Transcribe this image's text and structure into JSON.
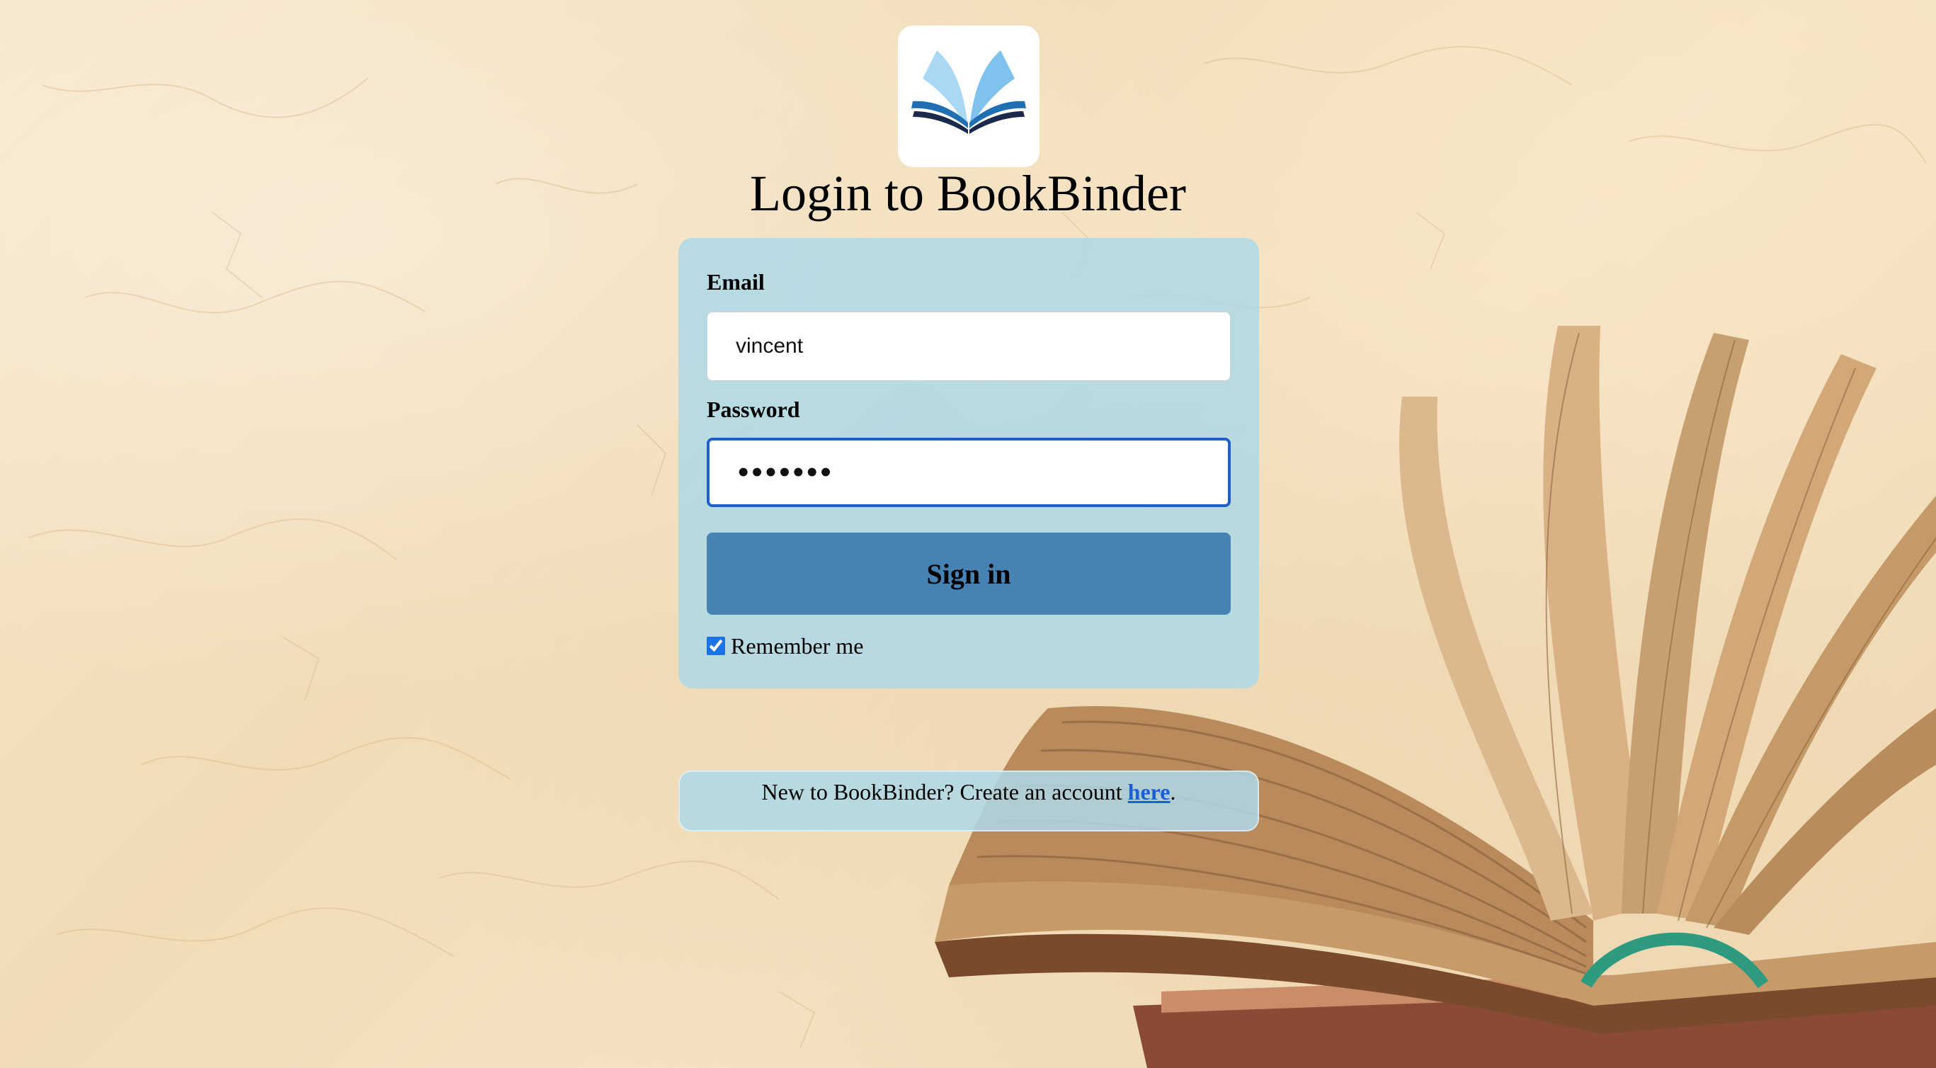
{
  "header": {
    "title": "Login to BookBinder",
    "logo_icon": "open-book-icon"
  },
  "login_form": {
    "email_label": "Email",
    "email_value": "vincent",
    "password_label": "Password",
    "password_value": "•••••••",
    "sign_in_label": "Sign in",
    "remember_label": "Remember me",
    "remember_checked": true
  },
  "signup": {
    "prompt": "New to BookBinder? Create an account ",
    "link_text": "here",
    "suffix": "."
  },
  "colors": {
    "card_background": "#add8e6",
    "button_background": "#4682b4",
    "focus_border": "#1f5fc7",
    "link": "#1a5fd6",
    "logo_light_blue": "#a9d8f5",
    "logo_mid_blue": "#1f6fb2",
    "logo_navy": "#1b2a4a"
  }
}
